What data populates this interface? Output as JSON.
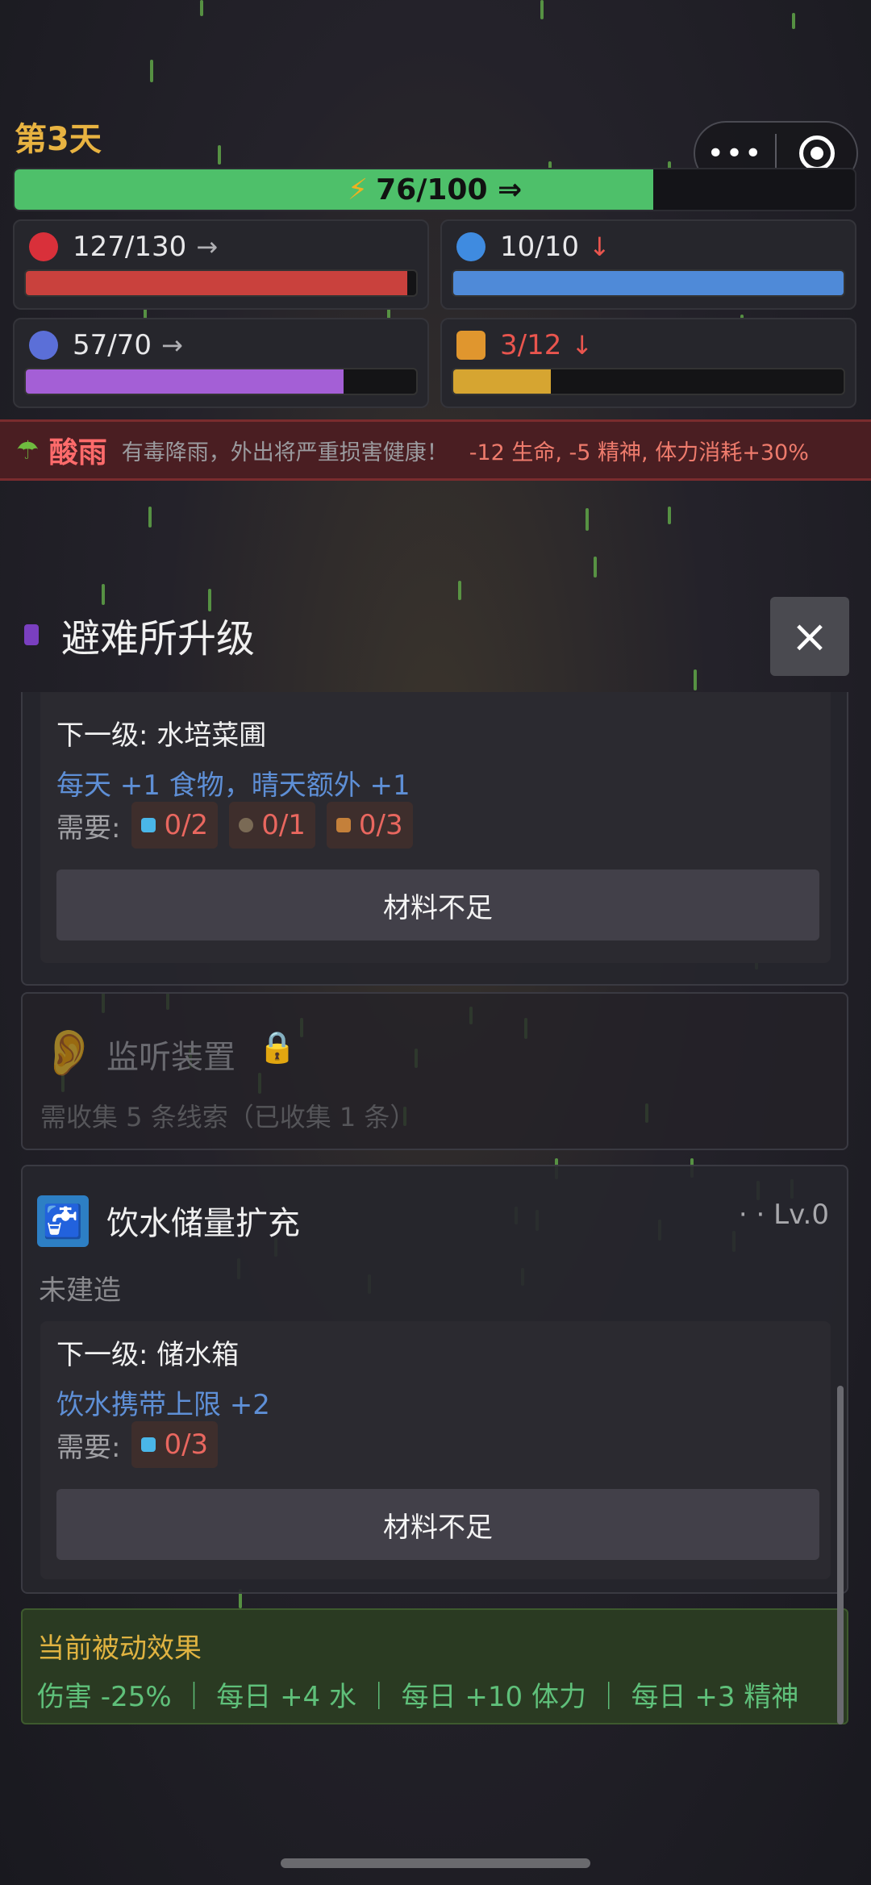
{
  "header": {
    "day": "第3天",
    "stamina": {
      "text": "76/100 ⇒",
      "current": 76,
      "max": 100
    },
    "capsule": {
      "more": "•••"
    }
  },
  "stats": {
    "health": {
      "text": "127/130",
      "trend": "→",
      "value": 127,
      "max": 130,
      "color": "#c9413d"
    },
    "water": {
      "text": "10/10",
      "trend": "↓",
      "value": 10,
      "max": 10,
      "color": "#4f8ad8"
    },
    "spirit": {
      "text": "57/70",
      "trend": "→",
      "value": 57,
      "max": 70,
      "color": "#a45fd6"
    },
    "food": {
      "text": "3/12",
      "trend": "↓",
      "value": 3,
      "max": 12,
      "color": "#d6a531"
    }
  },
  "weather": {
    "name": "酸雨",
    "description": "有毒降雨，外出将严重损害健康！",
    "effect": "-12 生命, -5 精神, 体力消耗+30%"
  },
  "modal": {
    "title": "避难所升级",
    "close": "×",
    "cards": {
      "hydro": {
        "next_level": "下一级: 水培菜圃",
        "effect": "每天 +1 食物，晴天额外 +1",
        "need_label": "需要:",
        "requirements": [
          "0/2",
          "0/1",
          "0/3"
        ],
        "button": "材料不足"
      },
      "listen": {
        "title": "监听装置",
        "hint": "需收集 5 条线索（已收集 1 条）"
      },
      "water": {
        "title": "饮水储量扩充",
        "level": "· · Lv.0",
        "status": "未建造",
        "next_level": "下一级: 储水箱",
        "effect": "饮水携带上限 +2",
        "need_label": "需要:",
        "requirements": [
          "0/3"
        ],
        "button": "材料不足"
      }
    },
    "passive": {
      "title": "当前被动效果",
      "effects": "伤害 -25% ｜ 每日 +4 水 ｜ 每日 +10 体力 ｜ 每日 +3 精神"
    }
  }
}
